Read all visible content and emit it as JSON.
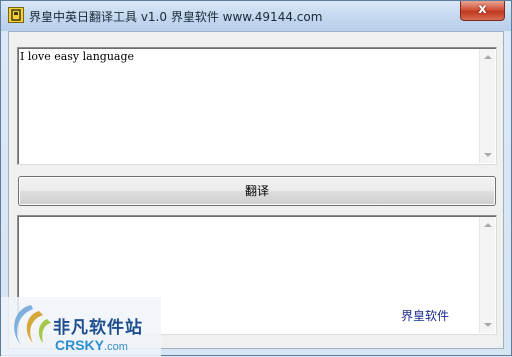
{
  "window": {
    "title": "界皇中英日翻译工具 v1.0  界皇软件 www.49144.com",
    "close_label": "x"
  },
  "input": {
    "value": "I love easy language"
  },
  "translate_button": {
    "label": "翻译"
  },
  "output": {
    "value": "",
    "brand_label": "界皇软件"
  },
  "watermark": {
    "name_cn": "非凡软件站",
    "name_en": "CRSKY",
    "domain_suffix": ".com"
  },
  "icons": [
    "app-icon",
    "close-icon",
    "scroll-up-icon",
    "scroll-down-icon",
    "watermark-logo-icon"
  ],
  "colors": {
    "title_bar": "#c3d7ee",
    "close_button": "#c1391f",
    "brand_text": "#1a2c8c",
    "watermark_blue": "#1d4f8f"
  }
}
